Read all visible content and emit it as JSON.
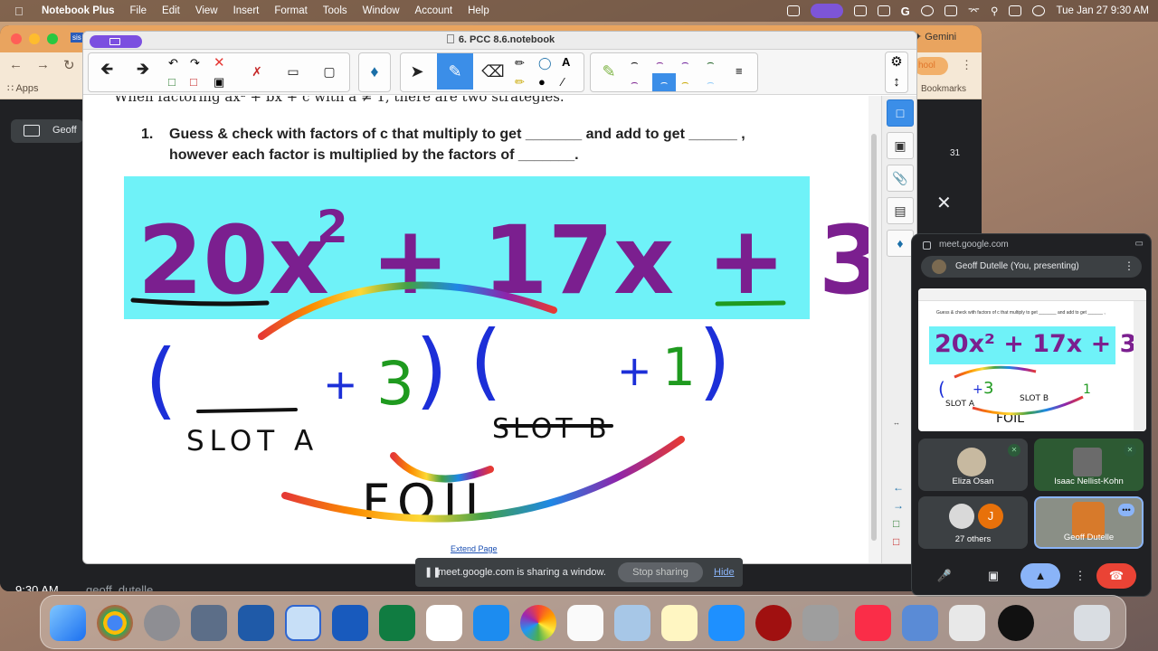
{
  "menubar": {
    "app_name": "Notebook Plus",
    "menus": [
      "File",
      "Edit",
      "View",
      "Insert",
      "Format",
      "Tools",
      "Window",
      "Account",
      "Help"
    ],
    "clock": "Tue Jan 27  9:30 AM"
  },
  "browser": {
    "gemini_label": "✦ Gemini",
    "apps_label": "Apps",
    "bookmarks_label": "Bookmarks",
    "school_label": "hool",
    "presenting_label": "Geoff",
    "time": "9:30 AM",
    "user": "geoff_dutelle",
    "participant_count": "31",
    "chip_label": "le",
    "tab_label": "sis"
  },
  "notebook": {
    "title": "6. PCC 8.6.notebook",
    "question_number": "1.",
    "question_line1": "Guess & check with factors of c that multiply to get _______ and add to get ______ ,",
    "question_line2": "however each factor is multiplied by the factors of _______.",
    "cut_off_line": "When factoring ax² + bx + c with a ≠ 1, there are two strategies.",
    "extend_page": "Extend Page",
    "equation": {
      "part1": "20x",
      "exp": "2",
      "part2": "+ 17x + 3"
    },
    "handwriting": {
      "plus3": "+",
      "three": "3",
      "plus1": "+",
      "one": "1",
      "slot_a": "SLOT A",
      "slot_b": "SLOT B",
      "foil": "FOIL",
      "open_paren": "(",
      "close_paren": ")"
    }
  },
  "meet": {
    "url": "meet.google.com",
    "presenter": "Geoff Dutelle (You, presenting)",
    "preview_eq": "20x² + 17x + 3",
    "participants": [
      {
        "name": "Eliza Osan"
      },
      {
        "name": "Isaac Nellist-Kohn"
      },
      {
        "name": "27 others"
      },
      {
        "name": "Geoff Dutelle"
      }
    ],
    "others_initial": "J"
  },
  "share_bar": {
    "message": "meet.google.com is sharing a window.",
    "stop": "Stop sharing",
    "hide": "Hide"
  },
  "colors": {
    "equation_bg": "#6ff2f8",
    "equation_text": "#7b1f8f",
    "ink_blue": "#1c2fd8",
    "ink_green": "#1f9a1f",
    "ink_black": "#111111",
    "accent_blue": "#3b8ee8"
  }
}
